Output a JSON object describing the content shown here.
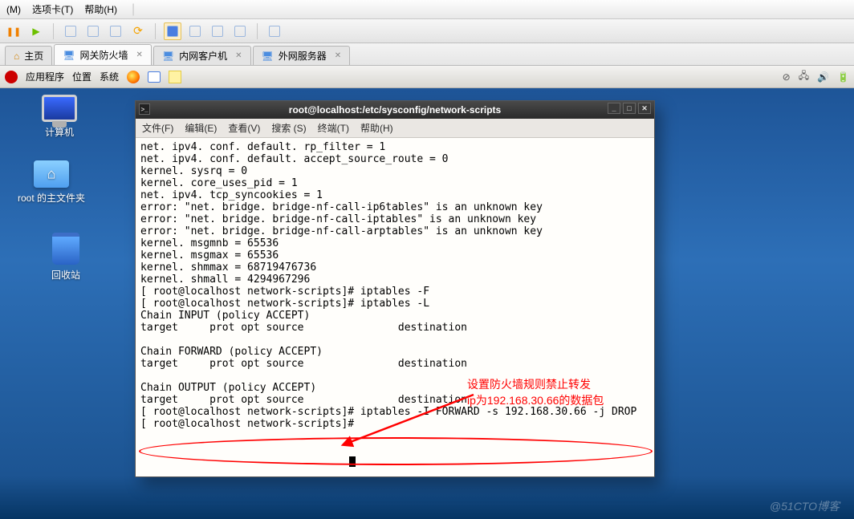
{
  "vm_menu": {
    "item1": "(M)",
    "item2": "选项卡(T)",
    "item3": "帮助(H)"
  },
  "vm_tabs": {
    "home": "主页",
    "items": [
      {
        "label": "网关防火墙"
      },
      {
        "label": "内网客户机"
      },
      {
        "label": "外网服务器"
      }
    ]
  },
  "gnome": {
    "apps": "应用程序",
    "places": "位置",
    "system": "系统"
  },
  "desktop": {
    "computer": "计算机",
    "home": "root 的主文件夹",
    "trash": "回收站"
  },
  "terminal": {
    "title": "root@localhost:/etc/sysconfig/network-scripts",
    "menu": {
      "file": "文件(F)",
      "edit": "编辑(E)",
      "view": "查看(V)",
      "search": "搜索 (S)",
      "term": "终端(T)",
      "help": "帮助(H)"
    },
    "content": "net. ipv4. conf. default. rp_filter = 1\nnet. ipv4. conf. default. accept_source_route = 0\nkernel. sysrq = 0\nkernel. core_uses_pid = 1\nnet. ipv4. tcp_syncookies = 1\nerror: \"net. bridge. bridge-nf-call-ip6tables\" is an unknown key\nerror: \"net. bridge. bridge-nf-call-iptables\" is an unknown key\nerror: \"net. bridge. bridge-nf-call-arptables\" is an unknown key\nkernel. msgmnb = 65536\nkernel. msgmax = 65536\nkernel. shmmax = 68719476736\nkernel. shmall = 4294967296\n[ root@localhost network-scripts]# iptables -F\n[ root@localhost network-scripts]# iptables -L\nChain INPUT (policy ACCEPT)\ntarget     prot opt source               destination\n\nChain FORWARD (policy ACCEPT)\ntarget     prot opt source               destination\n\nChain OUTPUT (policy ACCEPT)\ntarget     prot opt source               destination\n[ root@localhost network-scripts]# iptables -I FORWARD -s 192.168.30.66 -j DROP\n[ root@localhost network-scripts]# "
  },
  "annotation": {
    "line1": "设置防火墙规则禁止转发",
    "line2": "ip为192.168.30.66的数据包"
  },
  "watermark": "@51CTO博客"
}
